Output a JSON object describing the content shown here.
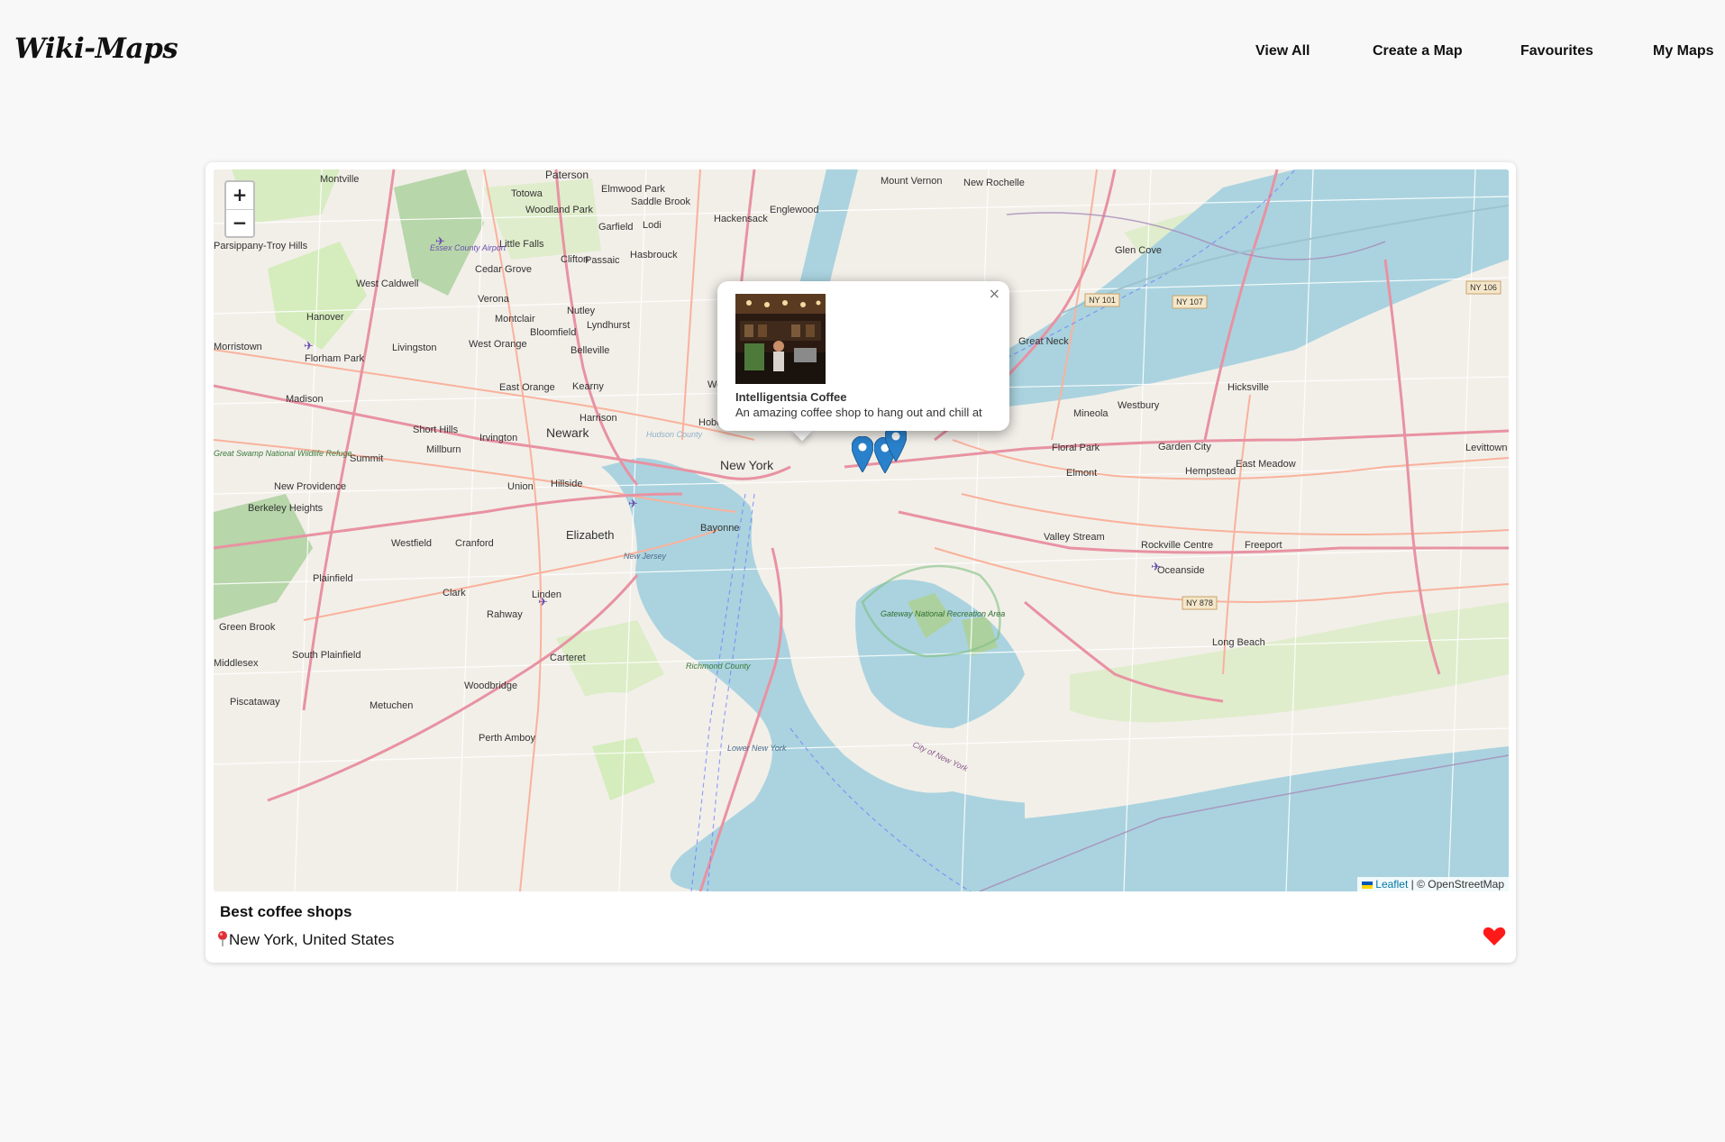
{
  "header": {
    "logo": "Wiki-Maps",
    "nav": [
      {
        "label": "View All"
      },
      {
        "label": "Create a Map"
      },
      {
        "label": "Favourites"
      },
      {
        "label": "My Maps"
      }
    ]
  },
  "map": {
    "zoom_in": "+",
    "zoom_out": "−",
    "attribution": {
      "leaflet": "Leaflet",
      "separator": " | © ",
      "osm": "OpenStreetMap"
    },
    "place_labels": [
      {
        "text": "Paterson"
      },
      {
        "text": "Mount Vernon"
      },
      {
        "text": "New Rochelle"
      },
      {
        "text": "Montville"
      },
      {
        "text": "Totowa"
      },
      {
        "text": "Elmwood Park"
      },
      {
        "text": "Woodland Park"
      },
      {
        "text": "Saddle Brook"
      },
      {
        "text": "Hackensack"
      },
      {
        "text": "Englewood"
      },
      {
        "text": "Garfield"
      },
      {
        "text": "Lodi"
      },
      {
        "text": "Little Falls"
      },
      {
        "text": "Clifton"
      },
      {
        "text": "Hasbrouck"
      },
      {
        "text": "Parsippany-Troy Hills"
      },
      {
        "text": "Essex County Airport"
      },
      {
        "text": "Cedar Grove"
      },
      {
        "text": "Passaic"
      },
      {
        "text": "Glen Cove"
      },
      {
        "text": "West Caldwell"
      },
      {
        "text": "Verona"
      },
      {
        "text": "Nutley"
      },
      {
        "text": "Hanover"
      },
      {
        "text": "Montclair"
      },
      {
        "text": "Lyndhurst"
      },
      {
        "text": "Bloomfield"
      },
      {
        "text": "Great Neck"
      },
      {
        "text": "Morristown"
      },
      {
        "text": "Livingston"
      },
      {
        "text": "West Orange"
      },
      {
        "text": "Belleville"
      },
      {
        "text": "Florham Park"
      },
      {
        "text": "Madison"
      },
      {
        "text": "East Orange"
      },
      {
        "text": "Kearny"
      },
      {
        "text": "Weehawken"
      },
      {
        "text": "Westbury"
      },
      {
        "text": "Hicksville"
      },
      {
        "text": "Mineola"
      },
      {
        "text": "Harrison"
      },
      {
        "text": "Hoboken"
      },
      {
        "text": "Short Hills"
      },
      {
        "text": "Newark"
      },
      {
        "text": "Irvington"
      },
      {
        "text": "Millburn"
      },
      {
        "text": "Summit"
      },
      {
        "text": "Great Swamp National Wildlife Refuge"
      },
      {
        "text": "Hudson County"
      },
      {
        "text": "New York"
      },
      {
        "text": "Floral Park"
      },
      {
        "text": "Garden City"
      },
      {
        "text": "Levittown"
      },
      {
        "text": "Hempstead"
      },
      {
        "text": "East Meadow"
      },
      {
        "text": "Elmont"
      },
      {
        "text": "New Providence"
      },
      {
        "text": "Union"
      },
      {
        "text": "Hillside"
      },
      {
        "text": "Berkeley Heights"
      },
      {
        "text": "Bayonne"
      },
      {
        "text": "Elizabeth"
      },
      {
        "text": "Westfield"
      },
      {
        "text": "Cranford"
      },
      {
        "text": "Valley Stream"
      },
      {
        "text": "Rockville Centre"
      },
      {
        "text": "Freeport"
      },
      {
        "text": "New Jersey"
      },
      {
        "text": "Oceanside"
      },
      {
        "text": "Plainfield"
      },
      {
        "text": "Clark"
      },
      {
        "text": "Linden"
      },
      {
        "text": "Rahway"
      },
      {
        "text": "Gateway National Recreation Area"
      },
      {
        "text": "Green Brook"
      },
      {
        "text": "Long Beach"
      },
      {
        "text": "South Plainfield"
      },
      {
        "text": "Carteret"
      },
      {
        "text": "Middlesex"
      },
      {
        "text": "Woodbridge"
      },
      {
        "text": "Richmond County"
      },
      {
        "text": "Piscataway"
      },
      {
        "text": "Metuchen"
      },
      {
        "text": "Perth Amboy"
      },
      {
        "text": "Lower New York"
      },
      {
        "text": "City of New York"
      }
    ],
    "shields": [
      "NY 101",
      "NY 107",
      "NY 106",
      "NY 878"
    ],
    "popup": {
      "title": "Intelligentsia Coffee",
      "description": "An amazing coffee shop to hang out and chill at",
      "close": "×"
    }
  },
  "card": {
    "title": "Best coffee shops",
    "location": "New York, United States",
    "favourite": true
  },
  "colors": {
    "water": "#aad3df",
    "land": "#f2efe9",
    "park": "#cdebb0",
    "forest": "#add19e",
    "motorway": "#e892a2",
    "primary": "#fcd6a4",
    "marker": "#2a81cb",
    "heart": "#ff1a1a"
  }
}
